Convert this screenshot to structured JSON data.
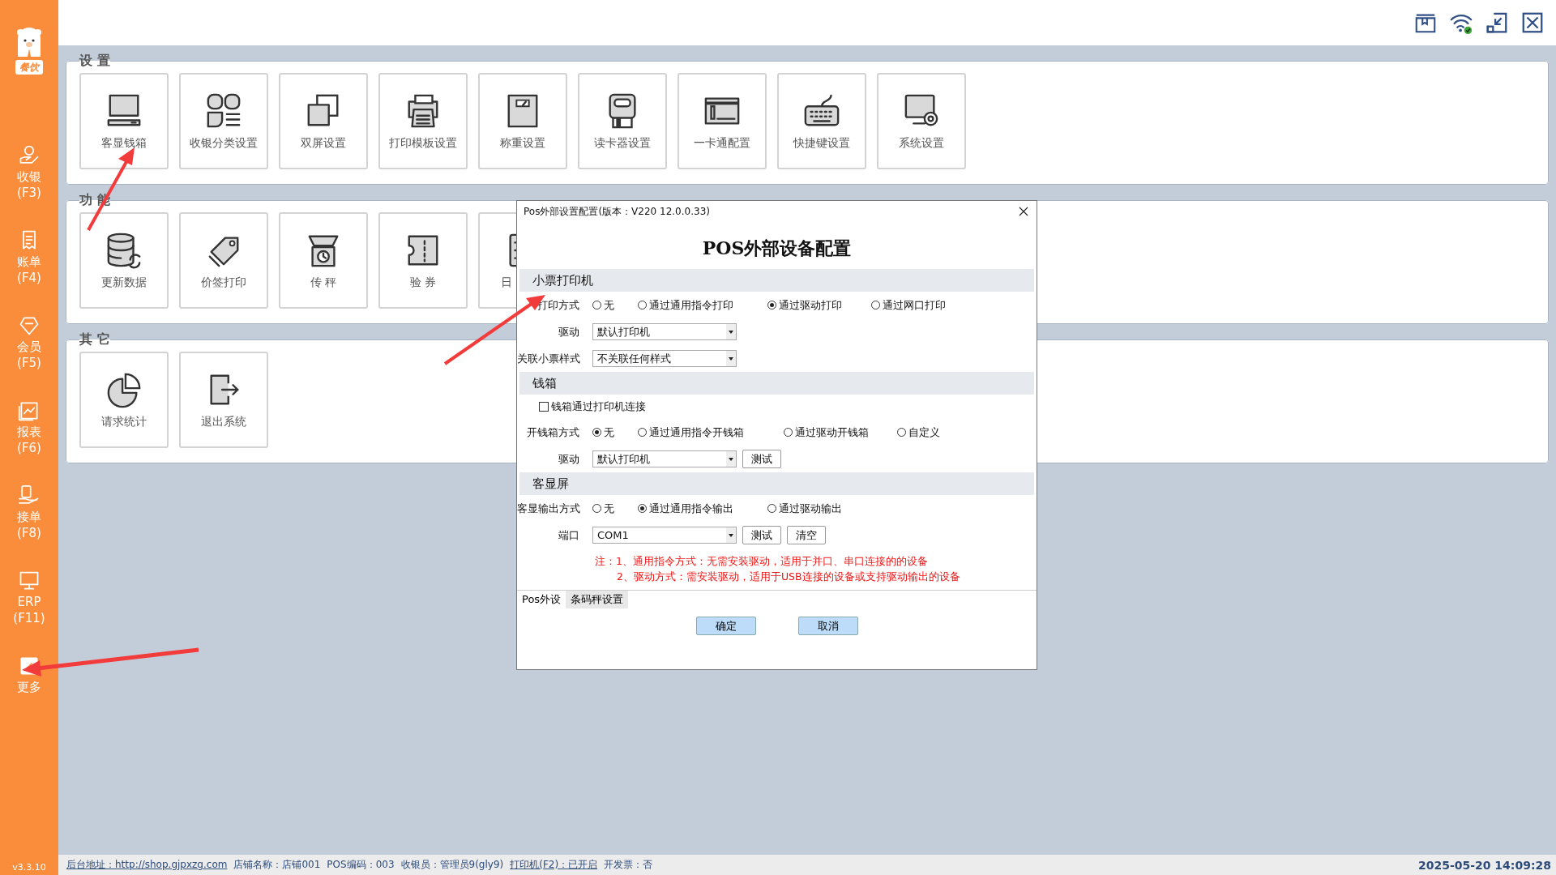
{
  "sidebar": {
    "logo_text": "餐饮",
    "items": [
      {
        "label": "收银",
        "shortcut": "(F3)"
      },
      {
        "label": "账单",
        "shortcut": "(F4)"
      },
      {
        "label": "会员",
        "shortcut": "(F5)"
      },
      {
        "label": "报表",
        "shortcut": "(F6)"
      },
      {
        "label": "接单",
        "shortcut": "(F8)"
      },
      {
        "label": "ERP",
        "shortcut": "(F11)"
      },
      {
        "label": "更多"
      }
    ],
    "version": "v3.3.10"
  },
  "sections": [
    {
      "title": "设 置",
      "tiles": [
        "客显钱箱",
        "收银分类设置",
        "双屏设置",
        "打印模板设置",
        "称重设置",
        "读卡器设置",
        "一卡通配置",
        "快捷键设置",
        "系统设置"
      ]
    },
    {
      "title": "功 能",
      "tiles": [
        "更新数据",
        "价签打印",
        "传 秤",
        "验 券",
        "日"
      ]
    },
    {
      "title": "其 它",
      "tiles": [
        "请求统计",
        "退出系统"
      ]
    }
  ],
  "dialog": {
    "title": "Pos外部设置配置(版本：V220  12.0.0.33)",
    "heading": "POS外部设备配置",
    "groups": [
      {
        "title": "小票打印机",
        "rows": [
          {
            "kind": "radio",
            "label": "打印方式",
            "options": [
              {
                "label": "无",
                "selected": false
              },
              {
                "label": "通过通用指令打印",
                "selected": false
              },
              {
                "label": "通过驱动打印",
                "selected": true
              },
              {
                "label": "通过网口打印",
                "selected": false
              }
            ]
          },
          {
            "kind": "select",
            "label": "驱动",
            "value": "默认打印机"
          },
          {
            "kind": "select",
            "label": "关联小票样式",
            "value": "不关联任何样式"
          }
        ]
      },
      {
        "title": "钱箱",
        "rows": [
          {
            "kind": "checkbox",
            "label": "钱箱通过打印机连接",
            "checked": false
          },
          {
            "kind": "radio",
            "label": "开钱箱方式",
            "options": [
              {
                "label": "无",
                "selected": true
              },
              {
                "label": "通过通用指令开钱箱",
                "selected": false
              },
              {
                "label": "通过驱动开钱箱",
                "selected": false
              },
              {
                "label": "自定义",
                "selected": false
              }
            ]
          },
          {
            "kind": "select",
            "label": "驱动",
            "value": "默认打印机",
            "buttons": [
              "测试"
            ]
          }
        ]
      },
      {
        "title": "客显屏",
        "rows": [
          {
            "kind": "radio",
            "label": "客显输出方式",
            "options": [
              {
                "label": "无",
                "selected": false
              },
              {
                "label": "通过通用指令输出",
                "selected": true
              },
              {
                "label": "通过驱动输出",
                "selected": false
              }
            ]
          },
          {
            "kind": "select",
            "label": "端口",
            "value": "COM1",
            "buttons": [
              "测试",
              "清空"
            ]
          }
        ]
      }
    ],
    "notes": [
      "注：1、通用指令方式：无需安装驱动，适用于并口、串口连接的的设备",
      "2、驱动方式：需安装驱动，适用于USB连接的设备或支持驱动输出的设备"
    ],
    "tabs": [
      {
        "label": "Pos外设",
        "selected": true
      },
      {
        "label": "条码秤设置",
        "selected": false
      }
    ],
    "buttons": [
      "确定",
      "取消"
    ]
  },
  "status_bar": {
    "items": [
      {
        "kind": "link",
        "text": "后台地址：http://shop.gjpxzg.com"
      },
      {
        "kind": "text",
        "text": "店铺名称：店铺001"
      },
      {
        "kind": "text",
        "text": "POS编码：003"
      },
      {
        "kind": "text",
        "text": "收银员：管理员9(gly9)"
      },
      {
        "kind": "link",
        "text": "打印机(F2)：已开启"
      },
      {
        "kind": "text",
        "text": "开发票：否"
      }
    ],
    "datetime": "2025-05-20 14:09:28"
  }
}
